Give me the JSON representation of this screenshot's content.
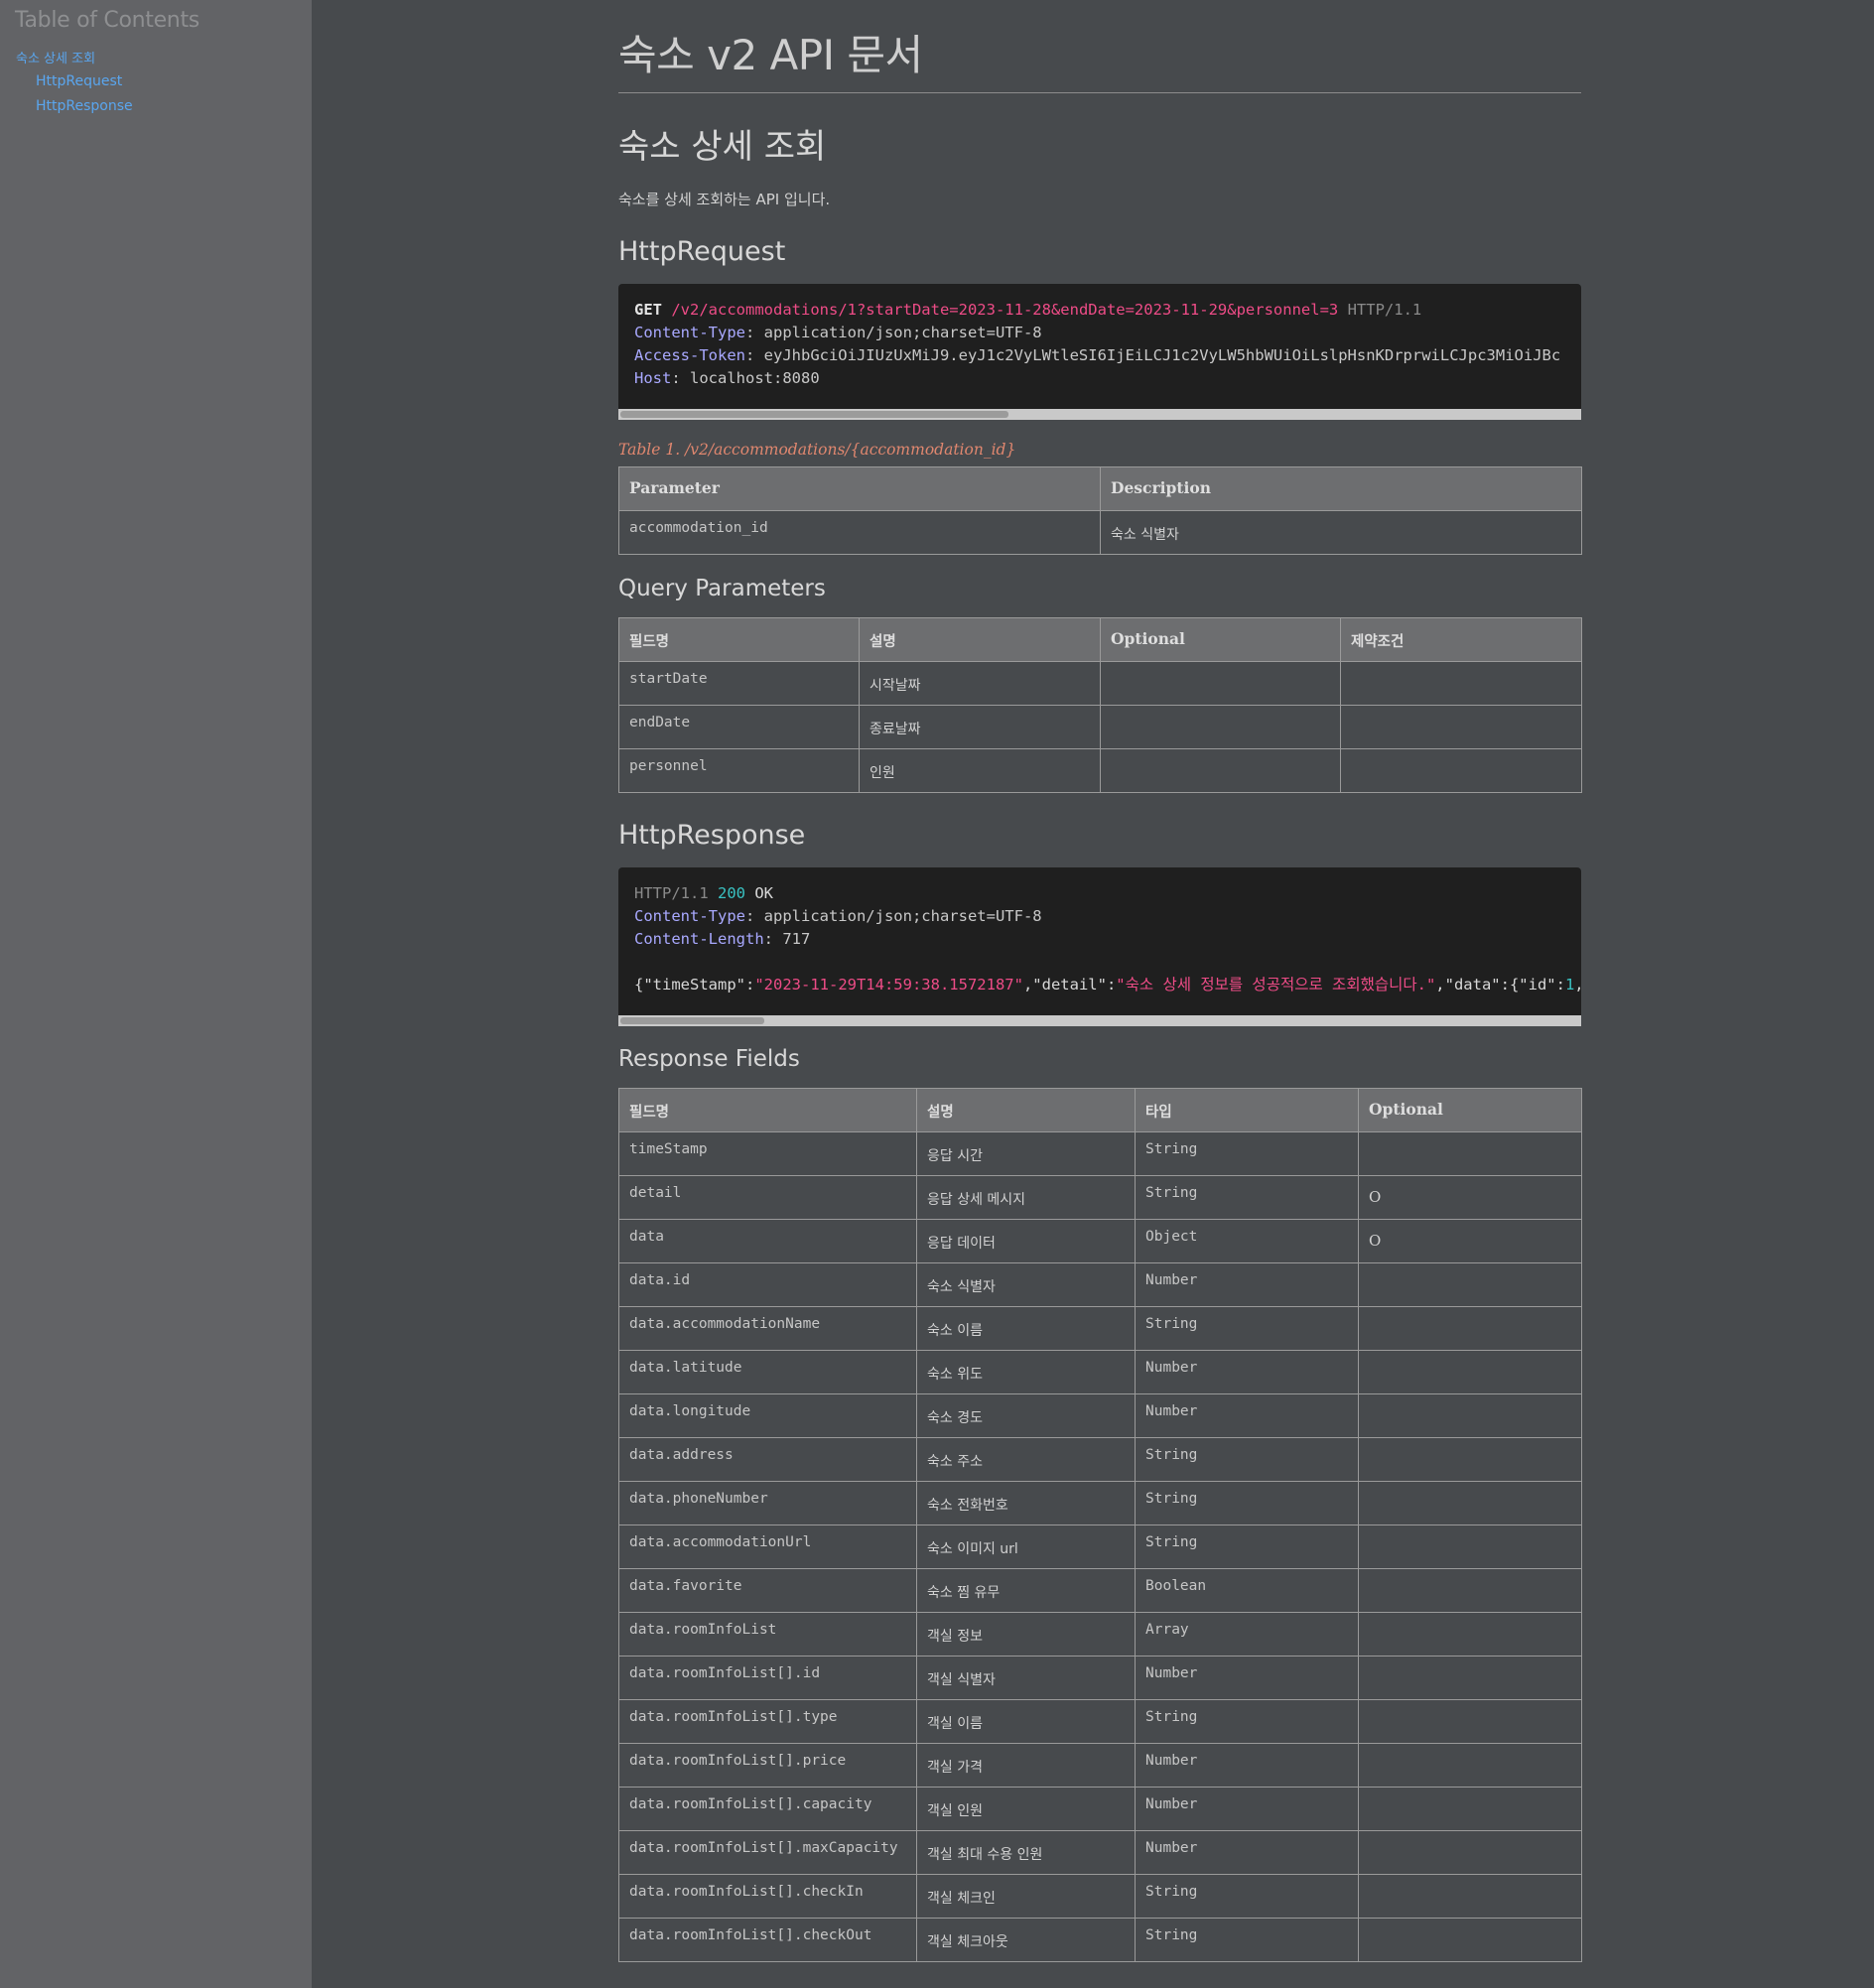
{
  "toc": {
    "title": "Table of Contents",
    "items": [
      {
        "label": "숙소 상세 조회"
      },
      {
        "label": "HttpRequest"
      },
      {
        "label": "HttpResponse"
      }
    ]
  },
  "doc": {
    "title": "숙소 v2 API 문서",
    "section_title": "숙소 상세 조회",
    "section_desc": "숙소를 상세 조회하는 API 입니다."
  },
  "request": {
    "heading": "HttpRequest",
    "method": "GET",
    "path": "/v2/accommodations/1?startDate=2023-11-28&endDate=2023-11-29&personnel=3",
    "version": "HTTP/1.1",
    "headers": [
      {
        "name": "Content-Type",
        "value": "application/json;charset=UTF-8"
      },
      {
        "name": "Access-Token",
        "value": "eyJhbGciOiJIUzUxMiJ9.eyJ1c2VyLWtleSI6IjEiLCJ1c2VyLW5hbWUiOiLslpHsnKDrprwiLCJpc3MiOiJBc"
      },
      {
        "name": "Host",
        "value": "localhost:8080"
      }
    ],
    "scroll_fraction": 0.405
  },
  "path_table": {
    "caption": "Table 1. /v2/accommodations/{accommodation_id}",
    "headers": [
      "Parameter",
      "Description"
    ],
    "rows": [
      {
        "field": "accommodation_id",
        "desc": "숙소 식별자"
      }
    ]
  },
  "query_params": {
    "heading": "Query Parameters",
    "headers": [
      "필드명",
      "설명",
      "Optional",
      "제약조건"
    ],
    "rows": [
      {
        "field": "startDate",
        "desc": "시작날짜",
        "optional": "",
        "constraint": ""
      },
      {
        "field": "endDate",
        "desc": "종료날짜",
        "optional": "",
        "constraint": ""
      },
      {
        "field": "personnel",
        "desc": "인원",
        "optional": "",
        "constraint": ""
      }
    ]
  },
  "response": {
    "heading": "HttpResponse",
    "version": "HTTP/1.1",
    "status_code": "200",
    "status_text": "OK",
    "headers": [
      {
        "name": "Content-Type",
        "value": "application/json;charset=UTF-8"
      },
      {
        "name": "Content-Length",
        "value": "717"
      }
    ],
    "body": {
      "p1": "{\"timeStamp\":",
      "s1": "\"2023-11-29T14:59:38.1572187\"",
      "p2": ",\"detail\":",
      "s2": "\"숙소 상세 정보를 성공적으로 조회했습니다.\"",
      "p3": ",\"data\":{\"id\":",
      "n1": "1",
      "p4": ","
    },
    "scroll_fraction": 0.15
  },
  "response_fields": {
    "heading": "Response Fields",
    "headers": [
      "필드명",
      "설명",
      "타입",
      "Optional"
    ],
    "rows": [
      {
        "field": "timeStamp",
        "desc": "응답 시간",
        "type": "String",
        "optional": ""
      },
      {
        "field": "detail",
        "desc": "응답 상세 메시지",
        "type": "String",
        "optional": "O"
      },
      {
        "field": "data",
        "desc": "응답 데이터",
        "type": "Object",
        "optional": "O"
      },
      {
        "field": "data.id",
        "desc": "숙소 식별자",
        "type": "Number",
        "optional": ""
      },
      {
        "field": "data.accommodationName",
        "desc": "숙소 이름",
        "type": "String",
        "optional": ""
      },
      {
        "field": "data.latitude",
        "desc": "숙소 위도",
        "type": "Number",
        "optional": ""
      },
      {
        "field": "data.longitude",
        "desc": "숙소 경도",
        "type": "Number",
        "optional": ""
      },
      {
        "field": "data.address",
        "desc": "숙소 주소",
        "type": "String",
        "optional": ""
      },
      {
        "field": "data.phoneNumber",
        "desc": "숙소 전화번호",
        "type": "String",
        "optional": ""
      },
      {
        "field": "data.accommodationUrl",
        "desc": "숙소 이미지 url",
        "type": "String",
        "optional": ""
      },
      {
        "field": "data.favorite",
        "desc": "숙소 찜 유무",
        "type": "Boolean",
        "optional": ""
      },
      {
        "field": "data.roomInfoList",
        "desc": "객실 정보",
        "type": "Array",
        "optional": ""
      },
      {
        "field": "data.roomInfoList[].id",
        "desc": "객실 식별자",
        "type": "Number",
        "optional": ""
      },
      {
        "field": "data.roomInfoList[].type",
        "desc": "객실 이름",
        "type": "String",
        "optional": ""
      },
      {
        "field": "data.roomInfoList[].price",
        "desc": "객실 가격",
        "type": "Number",
        "optional": ""
      },
      {
        "field": "data.roomInfoList[].capacity",
        "desc": "객실 인원",
        "type": "Number",
        "optional": ""
      },
      {
        "field": "data.roomInfoList[].maxCapacity",
        "desc": "객실 최대 수용 인원",
        "type": "Number",
        "optional": ""
      },
      {
        "field": "data.roomInfoList[].checkIn",
        "desc": "객실 체크인",
        "type": "String",
        "optional": ""
      },
      {
        "field": "data.roomInfoList[].checkOut",
        "desc": "객실 체크아웃",
        "type": "String",
        "optional": ""
      }
    ]
  }
}
